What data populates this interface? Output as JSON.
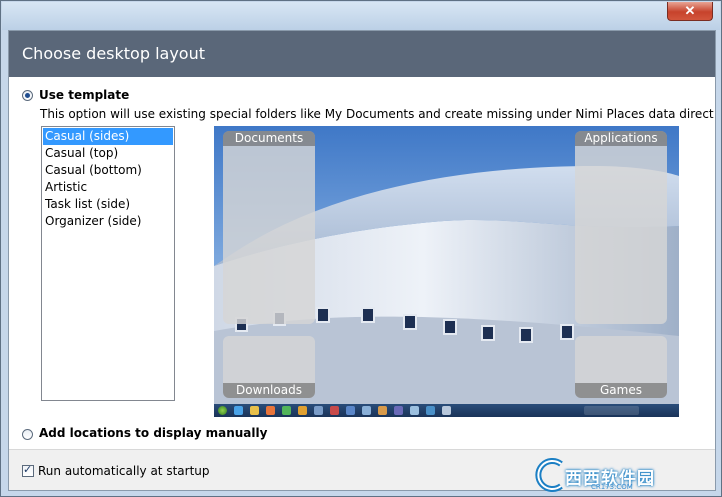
{
  "window": {
    "close_glyph": "✕"
  },
  "header": {
    "title": "Choose desktop layout"
  },
  "template_option": {
    "label": "Use template",
    "selected": true,
    "description": "This option will use existing special folders like My Documents and create missing under Nimi Places data direct"
  },
  "layouts": {
    "selected_index": 0,
    "items": [
      "Casual (sides)",
      "Casual (top)",
      "Casual (bottom)",
      "Artistic",
      "Task list (side)",
      "Organizer (side)"
    ]
  },
  "preview": {
    "zones": {
      "documents": "Documents",
      "applications": "Applications",
      "downloads": "Downloads",
      "games": "Games"
    },
    "taskbar_icons": [
      "start-orb",
      "ie",
      "explorer",
      "media",
      "chrome",
      "firefox",
      "app",
      "app",
      "app",
      "app",
      "app",
      "app",
      "app",
      "app",
      "app"
    ]
  },
  "manual_option": {
    "label": "Add locations to display manually",
    "selected": false
  },
  "startup": {
    "label": "Run automatically at startup",
    "checked": true
  },
  "watermark": {
    "text": "西西软件园",
    "sub": "CR173.COM"
  },
  "colors": {
    "header_bg": "#5a6779",
    "selection": "#3399ff",
    "close": "#c7432c"
  }
}
